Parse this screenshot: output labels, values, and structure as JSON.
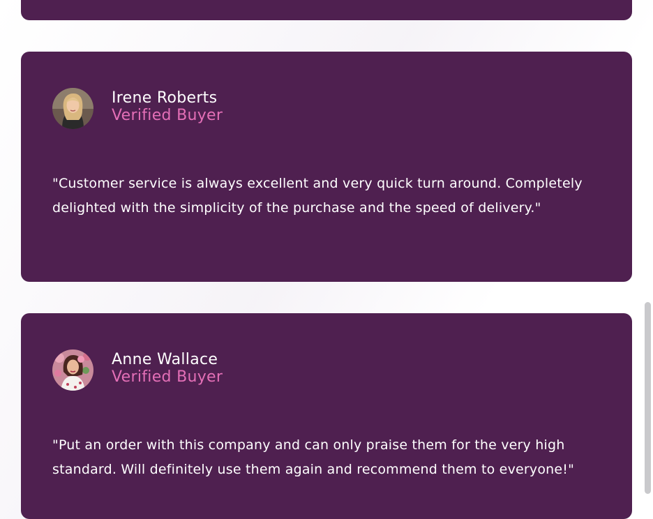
{
  "testimonials": [
    {
      "name": "Irene Roberts",
      "role": "Verified Buyer",
      "quote": "\"Customer service is always excellent and very quick turn around. Completely delighted with the simplicity of the purchase and the speed of delivery.\"",
      "avatar_icon": "woman-portrait-blonde"
    },
    {
      "name": "Anne Wallace",
      "role": "Verified Buyer",
      "quote": "\"Put an order with this company and can only praise them for the very high standard. Will definitely use them again and recommend them to everyone!\"",
      "avatar_icon": "woman-portrait-floral"
    }
  ],
  "colors": {
    "card_bg": "#4f2050",
    "name_text": "#ffffff",
    "role_text": "#e46fb7",
    "page_bg": "#ffffff"
  }
}
